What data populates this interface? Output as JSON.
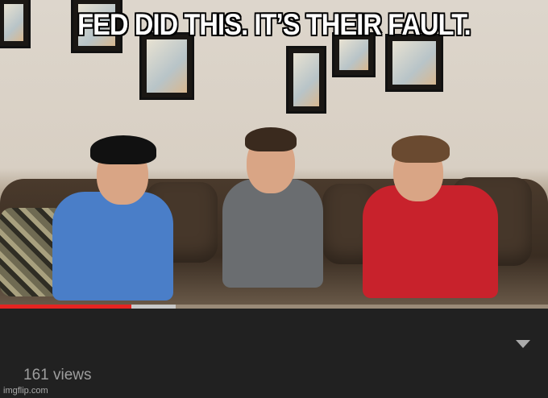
{
  "meme": {
    "caption": "FED DID THIS. IT’S THEIR FAULT.",
    "watermark": "imgflip.com"
  },
  "player": {
    "progress_played_fraction": 0.24,
    "progress_buffered_fraction": 0.32
  },
  "video_info": {
    "views": "161 views",
    "expand_icon": "chevron-down-icon"
  },
  "colors": {
    "played": "#e52421",
    "background": "#212121",
    "views_text": "#9e9e9e"
  }
}
